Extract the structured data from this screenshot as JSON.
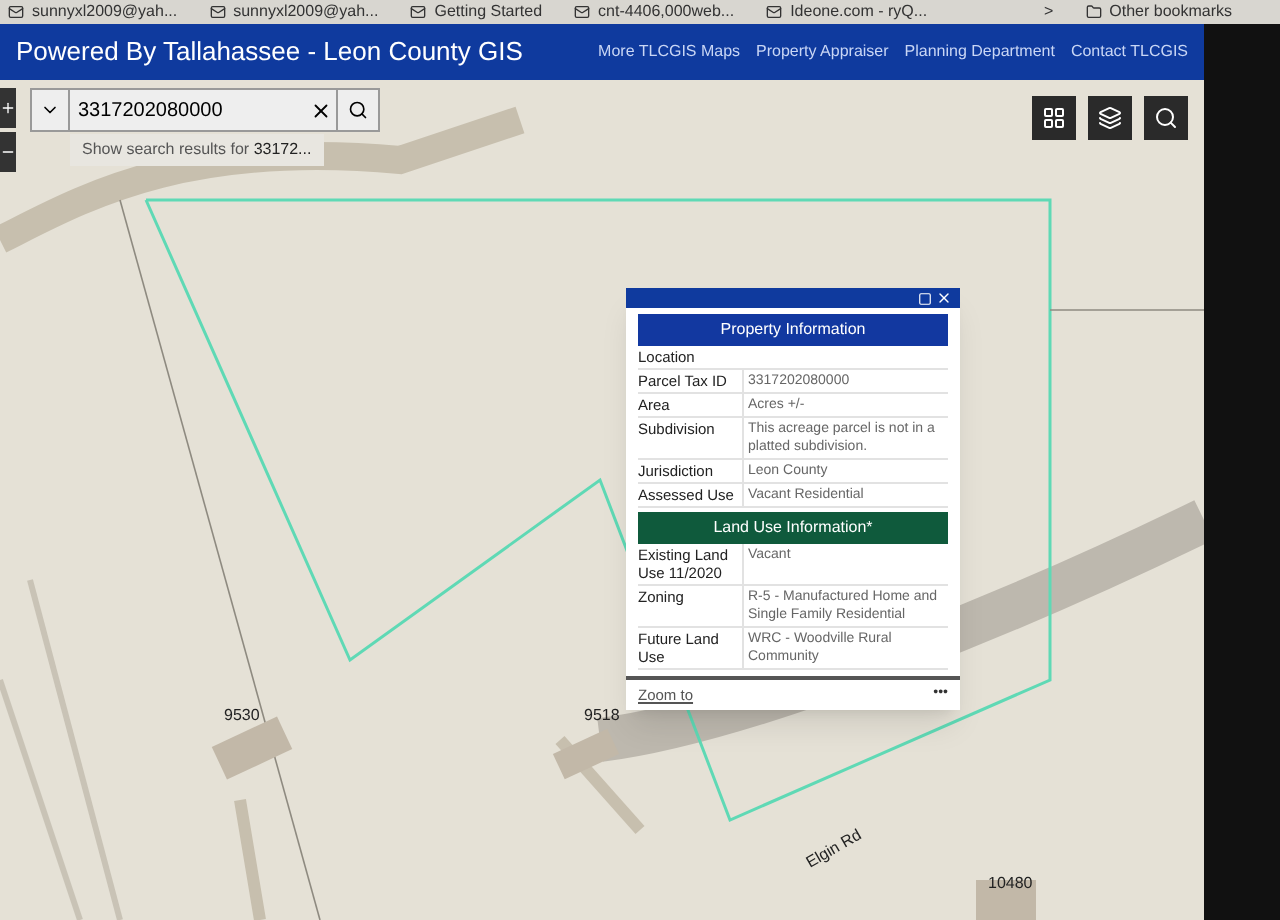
{
  "bookmarks": [
    "sunnyxl2009@yah...",
    "sunnyxl2009@yah...",
    "Getting Started",
    "cnt-4406,000web...",
    "Ideone.com - ryQ..."
  ],
  "bookmarks_more": ">",
  "other_bookmarks": "Other bookmarks",
  "header": {
    "title": "Powered By Tallahassee - Leon County GIS",
    "links": [
      "More TLCGIS Maps",
      "Property Appraiser",
      "Planning Department",
      "Contact TLCGIS"
    ]
  },
  "search": {
    "value": "3317202080000",
    "suggestion": "Show search results for ",
    "suggestion_term": "33172..."
  },
  "map_labels": {
    "addresses": [
      "9530",
      "9518",
      "10480"
    ],
    "road": "Elgin Rd"
  },
  "popup": {
    "sections": [
      {
        "title": "Property Information",
        "color": "#1238a0",
        "rows": [
          {
            "label": "Location",
            "value": ""
          },
          {
            "label": "Parcel Tax ID",
            "value": "3317202080000"
          },
          {
            "label": "Area",
            "value": "Acres +/-"
          },
          {
            "label": "Subdivision",
            "value": "This acreage parcel is not in a platted subdivision."
          },
          {
            "label": "Jurisdiction",
            "value": "Leon County"
          },
          {
            "label": "Assessed Use",
            "value": "Vacant Residential"
          }
        ]
      },
      {
        "title": "Land Use Information*",
        "color": "#0f5a3c",
        "rows": [
          {
            "label": "Existing Land Use 11/2020",
            "value": "Vacant"
          },
          {
            "label": "Zoning",
            "value": "R-5 - Manufactured Home and Single Family Residential"
          },
          {
            "label": "Future Land Use",
            "value": "WRC - Woodville Rural Community"
          }
        ]
      }
    ],
    "zoom_link": "Zoom to",
    "more": "•••"
  }
}
